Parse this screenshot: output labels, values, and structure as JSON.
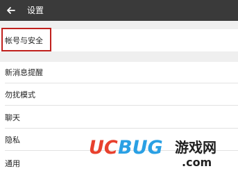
{
  "header": {
    "title": "设置",
    "back_icon": "arrow-left-icon"
  },
  "settings": {
    "account_security": "帐号与安全",
    "items": [
      "新消息提醒",
      "勿扰模式",
      "聊天",
      "隐私",
      "通用"
    ]
  },
  "watermark": {
    "brand": "UCBUG",
    "suffix": "游戏网",
    "domain": ".com"
  },
  "colors": {
    "topbar": "#3a3a3a",
    "highlight": "#c0201d",
    "background": "#efefef"
  }
}
